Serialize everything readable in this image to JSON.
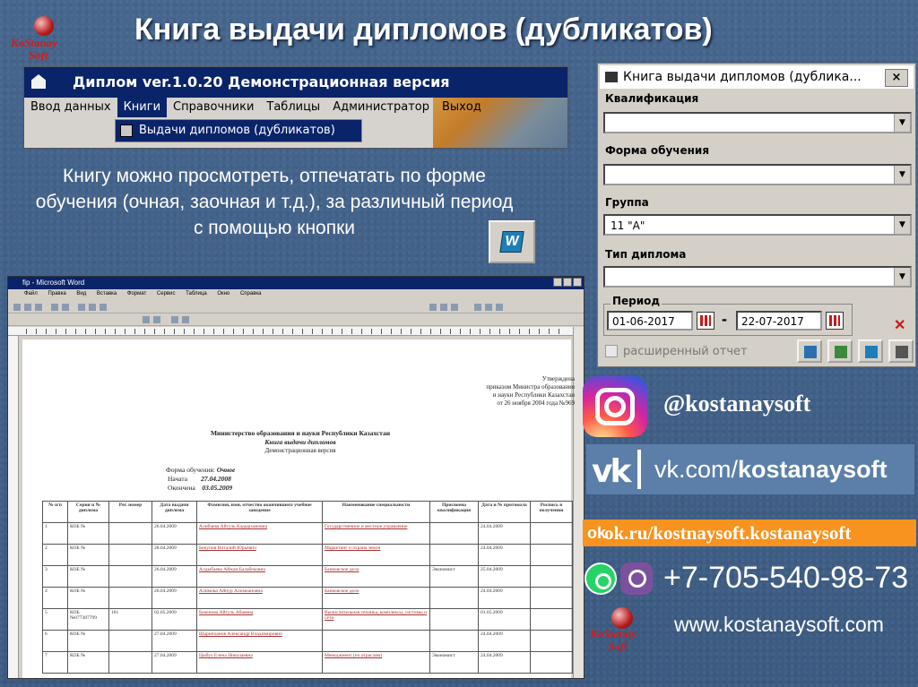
{
  "slide": {
    "title": "Книга выдачи дипломов (дубликатов)",
    "description": "Книгу можно просмотреть, отпечатать по форме обучения (очная,  заочная и т.д.), за различный период с  помощью кнопки",
    "logo_line1": "KoStanay",
    "logo_line2": "Soft"
  },
  "app_window": {
    "title": "Диплом ver.1.0.20 Демонстрационная версия",
    "menu": [
      "Ввод данных",
      "Книги",
      "Справочники",
      "Таблицы",
      "Администратор",
      "Выход"
    ],
    "active_menu": "Книги",
    "dropdown_item": "Выдачи дипломов (дубликатов)"
  },
  "word": {
    "title": "fip - Microsoft Word",
    "menu": [
      "Файл",
      "Правка",
      "Вид",
      "Вставка",
      "Формат",
      "Сервис",
      "Таблица",
      "Окно",
      "Справка"
    ],
    "approved": [
      "Утверждена",
      "приказом Министра образования",
      "и науки Республики Казахстан",
      "от 26 ноября 2004 года №969"
    ],
    "ministry": "Министерство образования и науки Республики Казахстан",
    "book_title": "Книга выдачи дипломов",
    "demo": "Демонстрационная версия",
    "form_label": "Форма обучения:",
    "form_value": "Очное",
    "start_label": "Начата",
    "start_value": "27.04.2008",
    "end_label": "Окончена",
    "end_value": "03.05.2009",
    "columns": [
      "№ п/п",
      "Серия и № диплома",
      "Рег. номер",
      "Дата выдачи диплома",
      "Фамилия, имя, отчество окончившего учебное заведение",
      "Наименование специальности",
      "Присвоена квалификация",
      "Дата и № протокола",
      "Роспись в получении"
    ],
    "rows": [
      [
        "1",
        "КОБ №",
        "",
        "26.04.2009",
        "Алибаева Айгуль Кадырхановна",
        "Государственное и местное управление",
        "",
        "24.04.2009",
        ""
      ],
      [
        "2",
        "КОБ №",
        "",
        "28.04.2009",
        "Бекупов Виталий Юрьевич",
        "Маркетинг и охрана земли",
        "",
        "24.04.2009",
        ""
      ],
      [
        "3",
        "КОБ №",
        "",
        "26.04.2009",
        "Алдыбаева Айжан Балабековна",
        "Банковское дело",
        "Экономист",
        "25.04.2009",
        ""
      ],
      [
        "4",
        "КОБ №",
        "",
        "26.04.2009",
        "Алимова Айнур Алимкановна",
        "Банковское дело",
        "",
        "24.04.2009",
        ""
      ],
      [
        "5",
        "КОБ №077387799",
        "181",
        "02.05.2009",
        "Бекенова Айгуль Абаевна",
        "Вычислительная техника, комплексы, системы и сети",
        "",
        "01.05.2009",
        ""
      ],
      [
        "6",
        "КОБ №",
        "",
        "27.04.2009",
        "Шарипханов Александр Владимирович",
        "",
        "",
        "24.04.2009",
        ""
      ],
      [
        "7",
        "КОБ №",
        "",
        "27.04.2009",
        "Цыбул Елена Николаевна",
        "Менеджмент (по отраслям)",
        "Экономист",
        "24.04.2009",
        ""
      ]
    ]
  },
  "dialog": {
    "title": "Книга выдачи дипломов (дублика...",
    "close_label": "×",
    "fields": [
      {
        "label": "Квалификация",
        "value": ""
      },
      {
        "label": "Форма обучения",
        "value": ""
      },
      {
        "label": "Группа",
        "value": "11 \"А\""
      },
      {
        "label": "Тип диплома",
        "value": ""
      }
    ],
    "period_label": "Период",
    "date_from": "01-06-2017",
    "date_to": "22-07-2017",
    "extended_report": "расширенный отчет"
  },
  "social": {
    "instagram": "@kostanaysoft",
    "vk_prefix": "vk.com/",
    "vk_handle": "kostanaysoft",
    "ok": "ok.ru/kostnaysoft.kostanaysoft",
    "phone": "+7-705-540-98-73",
    "site": "www.kostanaysoft.com"
  }
}
